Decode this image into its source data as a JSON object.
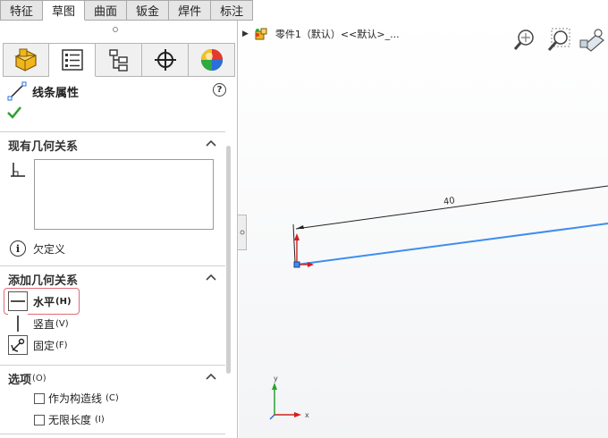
{
  "tabs": [
    "特征",
    "草图",
    "曲面",
    "钣金",
    "焊件",
    "标注"
  ],
  "active_tab": "草图",
  "panel": {
    "icon_tabs": [
      "featuremanager-icon",
      "propertymanager-icon",
      "configurationmanager-icon",
      "dimxpert-icon",
      "display-manager-icon"
    ],
    "title": "线条属性",
    "help": "?",
    "existing_relations": {
      "header": "现有几何关系",
      "status": "欠定义"
    },
    "add_relations": {
      "header": "添加几何关系",
      "horizontal": {
        "label": "水平",
        "key": "(H)"
      },
      "vertical": {
        "label": "竖直",
        "key": "(V)"
      },
      "fixed": {
        "label": "固定",
        "key": "(F)"
      }
    },
    "options": {
      "header": "选项",
      "header_key": "(O)",
      "construction": {
        "label": "作为构造线",
        "key": "(C)"
      },
      "infinite": {
        "label": "无限长度",
        "key": "(I)"
      }
    }
  },
  "viewport": {
    "tree_label": "零件1（默认）<<默认>_...",
    "dimension": "40",
    "axis_x": "x",
    "axis_y": "y",
    "line_color": "#3d8ef0",
    "tools": [
      "zoom-to-fit-icon",
      "zoom-to-area-icon",
      "view-orientation-icon"
    ]
  }
}
